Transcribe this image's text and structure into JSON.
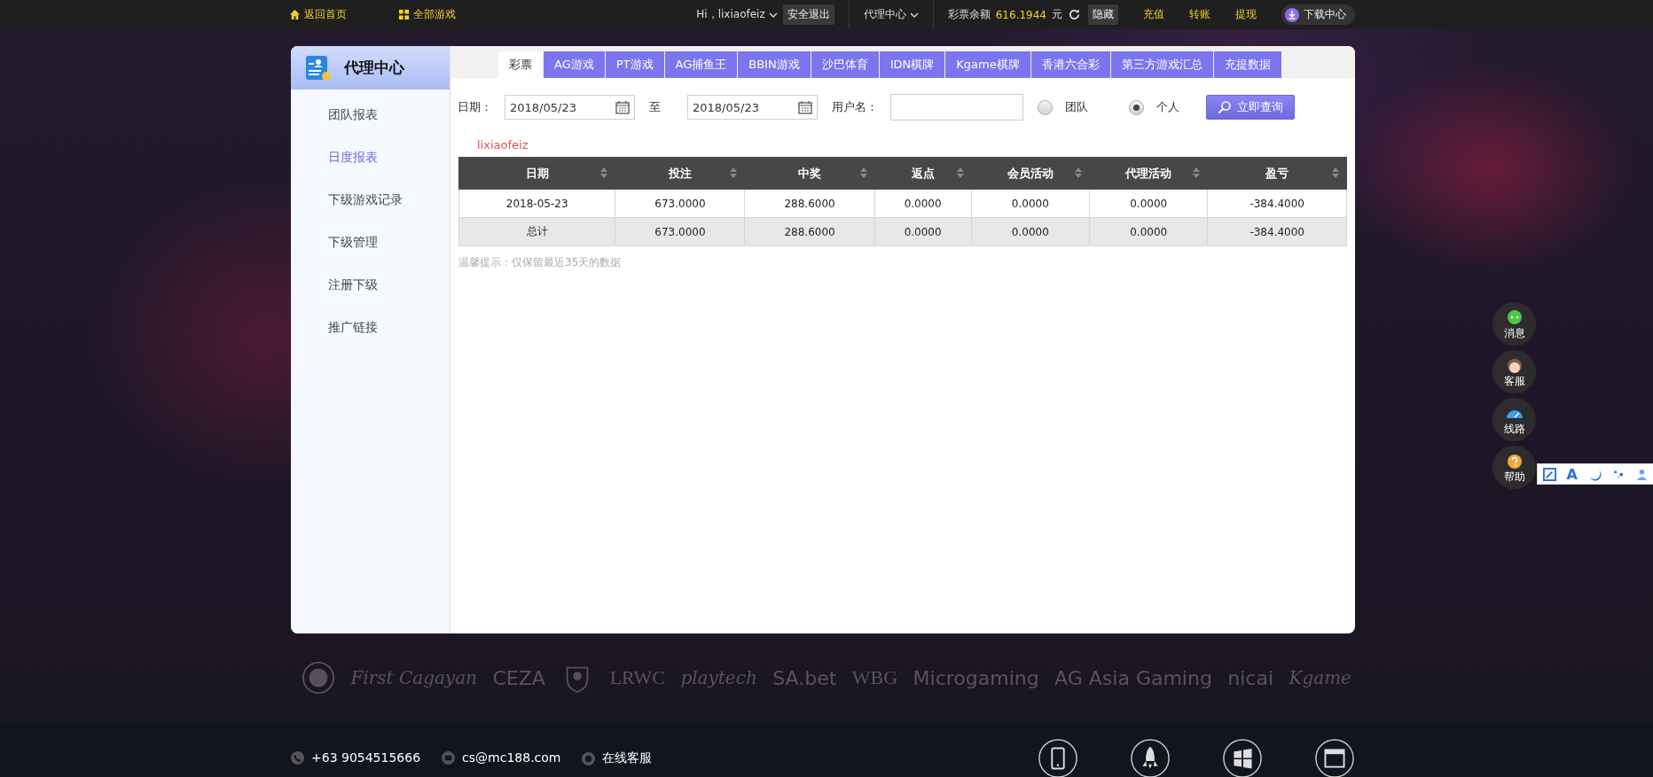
{
  "topbar": {
    "home_link": "返回首页",
    "games_link": "全部游戏",
    "greeting": "Hi，lixiaofeiz",
    "logout": "安全退出",
    "agent_menu": "代理中心",
    "balance_label": "彩票余额",
    "balance": "616.1944",
    "currency": "元",
    "hide_button": "隐藏",
    "actions": [
      "充值",
      "转账",
      "提现"
    ],
    "download": "下载中心"
  },
  "sidebar": {
    "title": "代理中心",
    "items": [
      {
        "label": "团队报表",
        "selected": false
      },
      {
        "label": "日度报表",
        "selected": true
      },
      {
        "label": "下级游戏记录",
        "selected": false
      },
      {
        "label": "下级管理",
        "selected": false
      },
      {
        "label": "注册下级",
        "selected": false
      },
      {
        "label": "推广链接",
        "selected": false
      }
    ]
  },
  "tabs": [
    {
      "label": "彩票",
      "selected": true
    },
    {
      "label": "AG游戏",
      "selected": false
    },
    {
      "label": "PT游戏",
      "selected": false
    },
    {
      "label": "AG捕鱼王",
      "selected": false
    },
    {
      "label": "BBIN游戏",
      "selected": false
    },
    {
      "label": "沙巴体育",
      "selected": false
    },
    {
      "label": "IDN棋牌",
      "selected": false
    },
    {
      "label": "Kgame棋牌",
      "selected": false
    },
    {
      "label": "香港六合彩",
      "selected": false
    },
    {
      "label": "第三方游戏汇总",
      "selected": false
    },
    {
      "label": "充提数据",
      "selected": false
    }
  ],
  "filter": {
    "date_label": "日期：",
    "start_date": "2018/05/23",
    "to_label": "至",
    "end_date": "2018/05/23",
    "username_label": "用户名：",
    "scope_options": [
      {
        "label": "团队",
        "selected": false
      },
      {
        "label": "个人",
        "selected": true
      }
    ],
    "query_button": "立即查询"
  },
  "username": "lixiaofeiz",
  "table": {
    "columns": [
      "日期",
      "投注",
      "中奖",
      "返点",
      "会员活动",
      "代理活动",
      "盈亏"
    ],
    "rows": [
      {
        "kind": "data",
        "cells": [
          "2018-05-23",
          "673.0000",
          "288.6000",
          "0.0000",
          "0.0000",
          "0.0000",
          "-384.4000"
        ]
      },
      {
        "kind": "total",
        "cells": [
          "总计",
          "673.0000",
          "288.6000",
          "0.0000",
          "0.0000",
          "0.0000",
          "-384.4000"
        ]
      }
    ]
  },
  "note": "温馨提示：仅保留最近35天的数据",
  "partners": [
    {
      "kind": "emblem"
    },
    {
      "kind": "script",
      "text": "First Cagayan"
    },
    {
      "kind": "text",
      "text": "CEZA"
    },
    {
      "kind": "crest"
    },
    {
      "kind": "serif",
      "text": "LRWC"
    },
    {
      "kind": "script",
      "text": "playtech"
    },
    {
      "kind": "text",
      "text": "SA.bet"
    },
    {
      "kind": "serif",
      "text": "WBG"
    },
    {
      "kind": "text",
      "text": "Microgaming"
    },
    {
      "kind": "text",
      "text": "AG Asia Gaming"
    },
    {
      "kind": "text",
      "text": "nicai"
    },
    {
      "kind": "script",
      "text": "Kgame"
    }
  ],
  "footer": {
    "phone": "+63 9054515666",
    "email": "cs@mc188.com",
    "live_chat": "在线客服",
    "apps": [
      {
        "kind": "phone"
      },
      {
        "kind": "rocket"
      },
      {
        "kind": "windows"
      },
      {
        "kind": "browser"
      }
    ]
  },
  "float_buttons": [
    {
      "kind": "message",
      "label": "消息"
    },
    {
      "kind": "service",
      "label": "客服"
    },
    {
      "kind": "route",
      "label": "线路"
    },
    {
      "kind": "help",
      "label": "帮助"
    }
  ],
  "float_toolbar": {
    "font_glyph": "A"
  }
}
